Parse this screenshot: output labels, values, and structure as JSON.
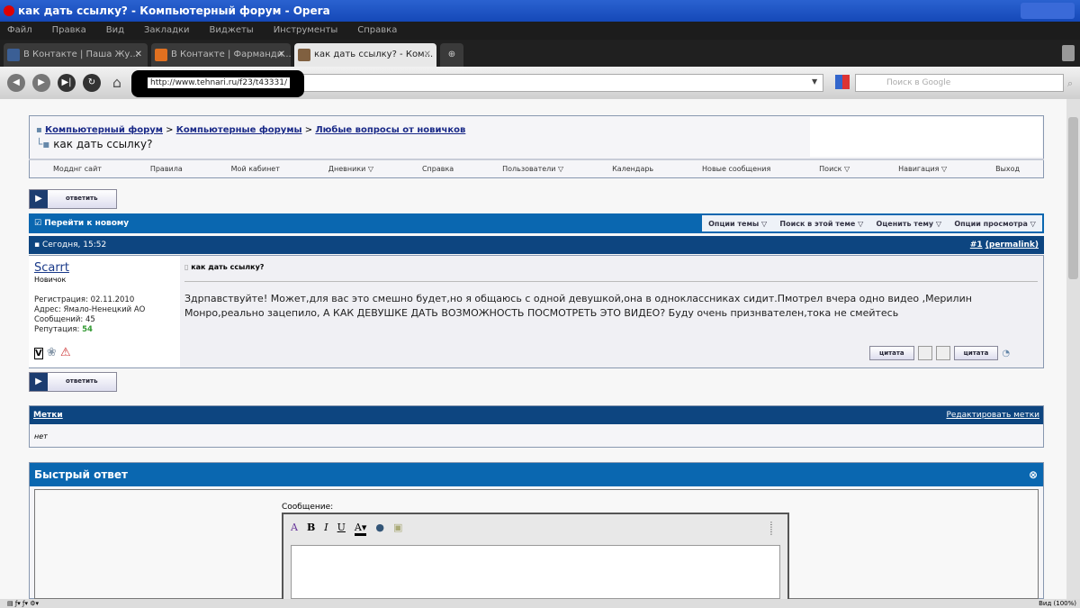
{
  "window": {
    "title": "как дать ссылку? - Компьютерный форум - Opera"
  },
  "menu": [
    "Файл",
    "Правка",
    "Вид",
    "Закладки",
    "Виджеты",
    "Инструменты",
    "Справка"
  ],
  "tabs": [
    {
      "label": "В Контакте | Паша Жу...",
      "color": "#3b5f95"
    },
    {
      "label": "В Контакте | Фарманди...",
      "color": "#e07020"
    },
    {
      "label": "как дать ссылку? - Ком...",
      "color": "#806040"
    }
  ],
  "address": {
    "url": "http://www.tehnari.ru/f23/t43331/",
    "search_placeholder": "Поиск в Google"
  },
  "breadcrumb": {
    "items": [
      "Компьютерный форум",
      "Компьютерные форумы",
      "Любые вопросы от новичков"
    ],
    "sep": ">",
    "current": "как дать ссылку?"
  },
  "nav": [
    "Модднг сайт",
    "Правила",
    "Мой кабинет",
    "Дневники ▽",
    "Справка",
    "Пользователи ▽",
    "Календарь",
    "Новые сообщения",
    "Поиск ▽",
    "Навигация ▽",
    "Выход"
  ],
  "reply_button": "ответить",
  "thread_bar": {
    "goto_new": "Перейти к новому",
    "options": [
      "Опции темы ▽",
      "Поиск в этой теме ▽",
      "Оценить тему ▽",
      "Опции просмотра ▽"
    ]
  },
  "post": {
    "date": "Сегодня, 15:52",
    "number": "#1",
    "permalink": "(permalink)",
    "user": "Scarrt",
    "rank": "Новичок",
    "registration": "Регистрация: 02.11.2010",
    "address": "Адрес: Ямало-Ненецкий АО",
    "posts": "Сообщений: 45",
    "reputation_label": "Репутация:",
    "reputation": "54",
    "title": "как дать ссылку?",
    "body": "Здрпавствуйте! Может,для вас это смешно будет,но я общаюсь с одной девушкой,она в одноклассниках сидит.Пмотрел вчера одно видео ,Мерилин Монро,реально зацепило, А КАК ДЕВУШКЕ ДАТЬ ВОЗМОЖНОСТЬ ПОСМОТРЕТЬ ЭТО ВИДЕО? Буду очень признвателен,тока не смейтесь",
    "quote_label": "цитата",
    "multiquote_label": "цитата"
  },
  "tags": {
    "title": "Метки",
    "edit": "Редактировать метки",
    "value": "нет"
  },
  "quick_reply": {
    "title": "Быстрый ответ",
    "message_label": "Сообщение:"
  },
  "status": {
    "zoom": "Вид (100%)"
  }
}
